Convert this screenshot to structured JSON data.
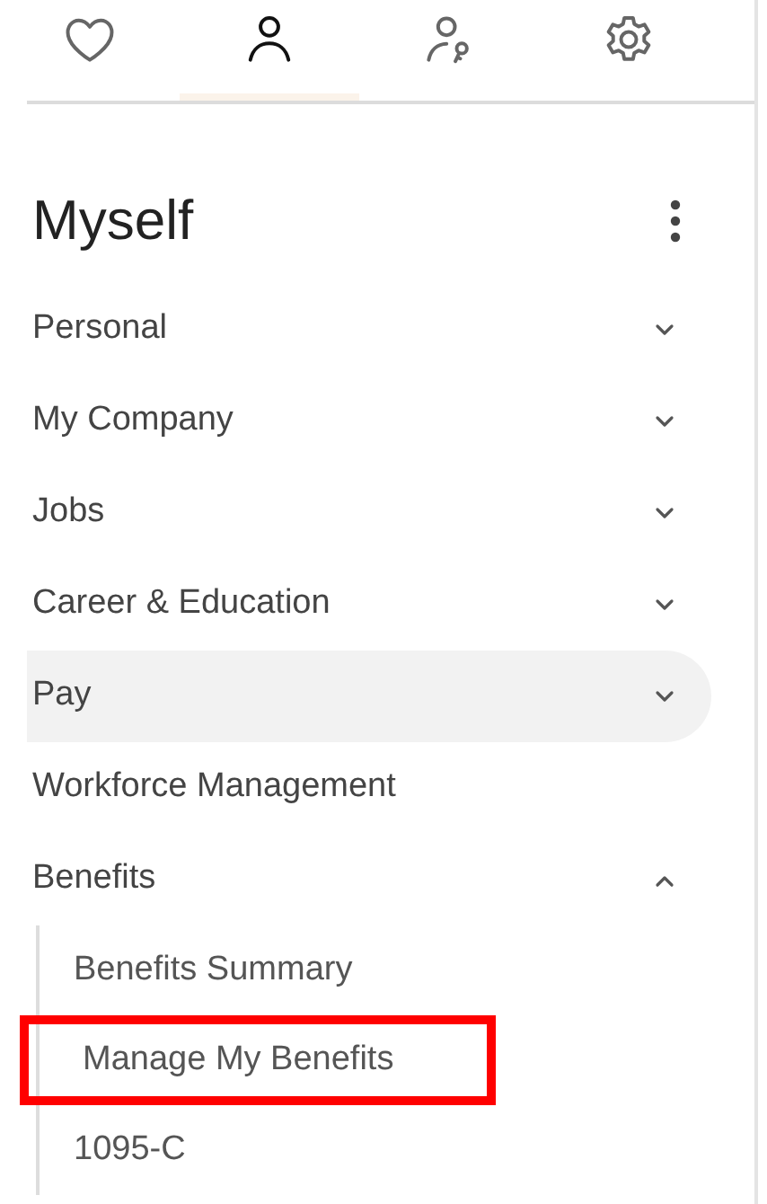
{
  "tabs": [
    {
      "selected": false
    },
    {
      "selected": true
    },
    {
      "selected": false
    },
    {
      "selected": false
    }
  ],
  "title": "Myself",
  "menu": [
    {
      "label": "Personal",
      "kind": "group",
      "expanded": false,
      "hovered": false
    },
    {
      "label": "My Company",
      "kind": "group",
      "expanded": false,
      "hovered": false
    },
    {
      "label": "Jobs",
      "kind": "group",
      "expanded": false,
      "hovered": false
    },
    {
      "label": "Career & Education",
      "kind": "group",
      "expanded": false,
      "hovered": false
    },
    {
      "label": "Pay",
      "kind": "group",
      "expanded": false,
      "hovered": true
    },
    {
      "label": "Workforce Management",
      "kind": "link",
      "hovered": false
    },
    {
      "label": "Benefits",
      "kind": "group",
      "expanded": true,
      "hovered": false,
      "children": [
        {
          "label": "Benefits Summary",
          "outlined": false
        },
        {
          "label": "Manage My Benefits",
          "outlined": true
        },
        {
          "label": "1095-C",
          "outlined": false
        }
      ]
    }
  ]
}
